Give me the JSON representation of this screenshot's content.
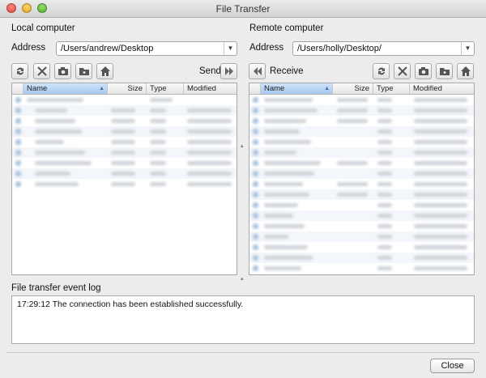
{
  "window": {
    "title": "File Transfer"
  },
  "local": {
    "heading": "Local computer",
    "address_label": "Address",
    "address_value": "/Users/andrew/Desktop",
    "send_label": "Send",
    "columns": [
      "Name",
      "Size",
      "Type",
      "Modified"
    ],
    "sorted_column": "Name",
    "toolbar_icons": [
      "refresh-icon",
      "delete-icon",
      "camera-icon",
      "new-folder-icon",
      "home-icon",
      "send-arrow-icon"
    ]
  },
  "remote": {
    "heading": "Remote computer",
    "address_label": "Address",
    "address_value": "/Users/holly/Desktop/",
    "receive_label": "Receive",
    "columns": [
      "Name",
      "Size",
      "Type",
      "Modified"
    ],
    "sorted_column": "Name",
    "toolbar_icons": [
      "receive-arrow-icon",
      "refresh-icon",
      "delete-icon",
      "camera-icon",
      "new-folder-icon",
      "home-icon"
    ]
  },
  "log": {
    "heading": "File transfer event log",
    "entries": [
      "17:29:12 The connection has been established successfully."
    ]
  },
  "footer": {
    "close_label": "Close"
  },
  "colors": {
    "sorted_header": "#a7c8ef",
    "accent": "#4a6fa5"
  }
}
